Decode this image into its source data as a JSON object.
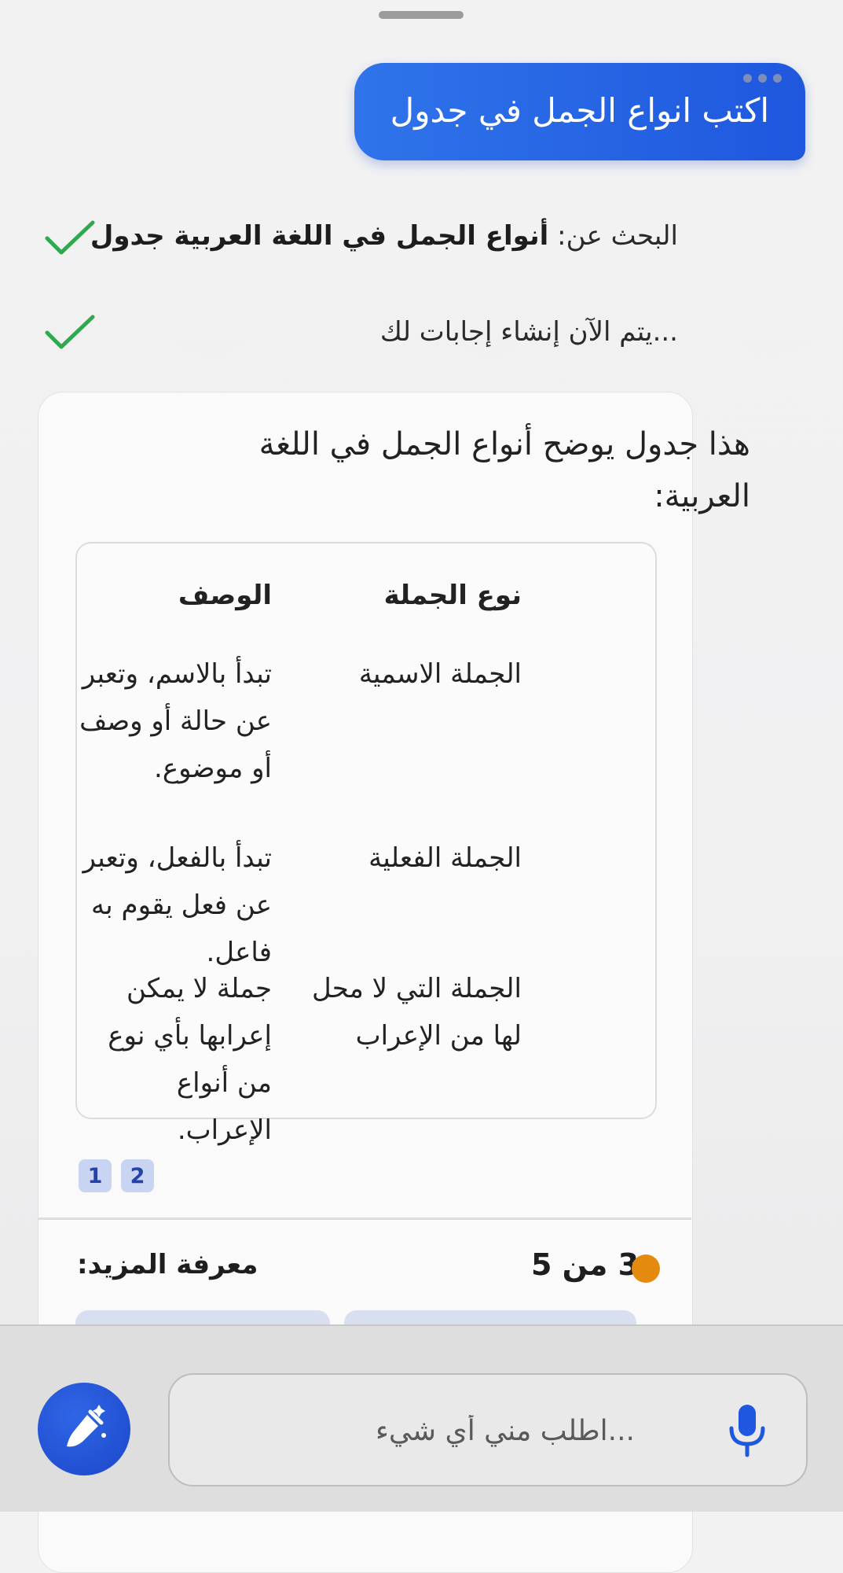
{
  "user_message": "اكتب انواع الجمل في جدول",
  "status": {
    "search_prefix": "البحث عن:",
    "search_query": "أنواع الجمل في اللغة العربية جدول",
    "generating": "...يتم الآن إنشاء إجابات لك"
  },
  "answer": {
    "intro": "هذا جدول يوضح أنواع الجمل في اللغة العربية:",
    "table": {
      "headers": [
        "نوع الجملة",
        "الوصف"
      ],
      "rows": [
        [
          "الجملة الاسمية",
          "تبدأ بالاسم، وتعبر عن حالة أو وصف أو موضوع."
        ],
        [
          "الجملة الفعلية",
          "تبدأ بالفعل، وتعبر عن فعل يقوم به فاعل."
        ],
        [
          "الجملة التي لا محل لها من الإعراب",
          "جملة لا يمكن إعرابها بأي نوع من أنواع الإعراب."
        ]
      ]
    },
    "citations": [
      "1",
      "2"
    ],
    "learn_more": "معرفة المزيد:",
    "counter": "3 من 5"
  },
  "input": {
    "placeholder": "...اطلب مني أي شيء"
  },
  "colors": {
    "accent": "#1f57de",
    "check": "#2fa84f",
    "counter_dot": "#e48a0f"
  },
  "icons": [
    "check-icon",
    "more-dots-icon",
    "new-topic-broom-icon",
    "microphone-icon"
  ]
}
